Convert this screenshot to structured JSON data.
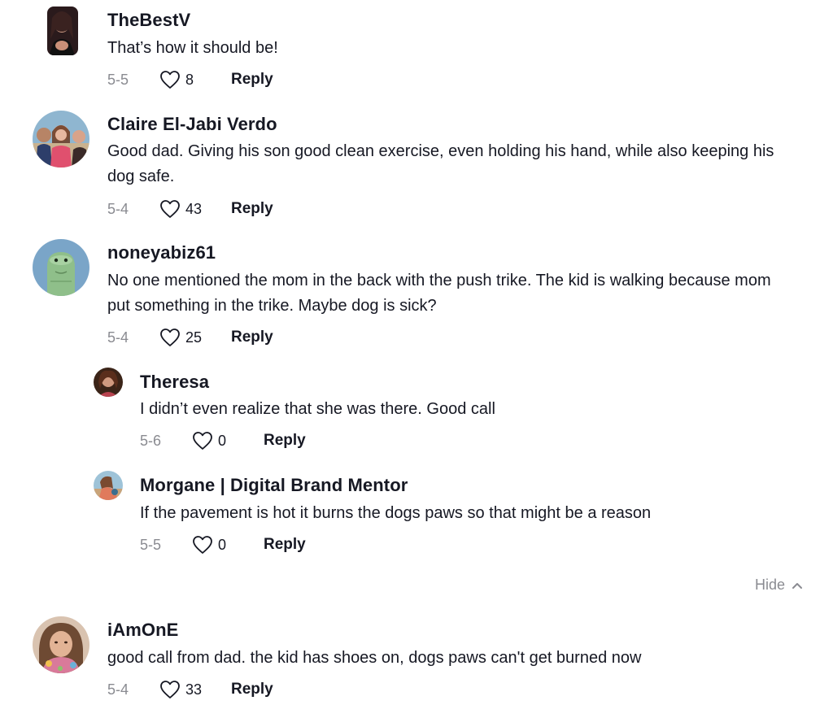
{
  "comments": [
    {
      "username": "TheBestV",
      "text": "That’s how it should be!",
      "date": "5-5",
      "likes": "8",
      "reply_label": "Reply"
    },
    {
      "username": "Claire El-Jabi Verdo",
      "text": "Good dad. Giving his son good clean exercise, even holding his hand, while also keeping his dog safe.",
      "date": "5-4",
      "likes": "43",
      "reply_label": "Reply"
    },
    {
      "username": "noneyabiz61",
      "text": "No one mentioned the mom in the back with the push trike. The kid is walking because mom put something in the trike. Maybe dog is sick?",
      "date": "5-4",
      "likes": "25",
      "reply_label": "Reply",
      "replies": [
        {
          "username": "Theresa",
          "text": "I didn’t even realize that she was there. Good call",
          "date": "5-6",
          "likes": "0",
          "reply_label": "Reply"
        },
        {
          "username": "Morgane | Digital Brand Mentor",
          "text": "If the pavement is hot it burns the dogs paws so that might be a reason",
          "date": "5-5",
          "likes": "0",
          "reply_label": "Reply"
        }
      ],
      "hide_label": "Hide"
    },
    {
      "username": "iAmOnE",
      "text": "good call from dad. the kid has shoes on, dogs paws can't get burned now",
      "date": "5-4",
      "likes": "33",
      "reply_label": "Reply"
    }
  ],
  "colors": {
    "text": "#161823",
    "muted": "#8a8b91"
  }
}
